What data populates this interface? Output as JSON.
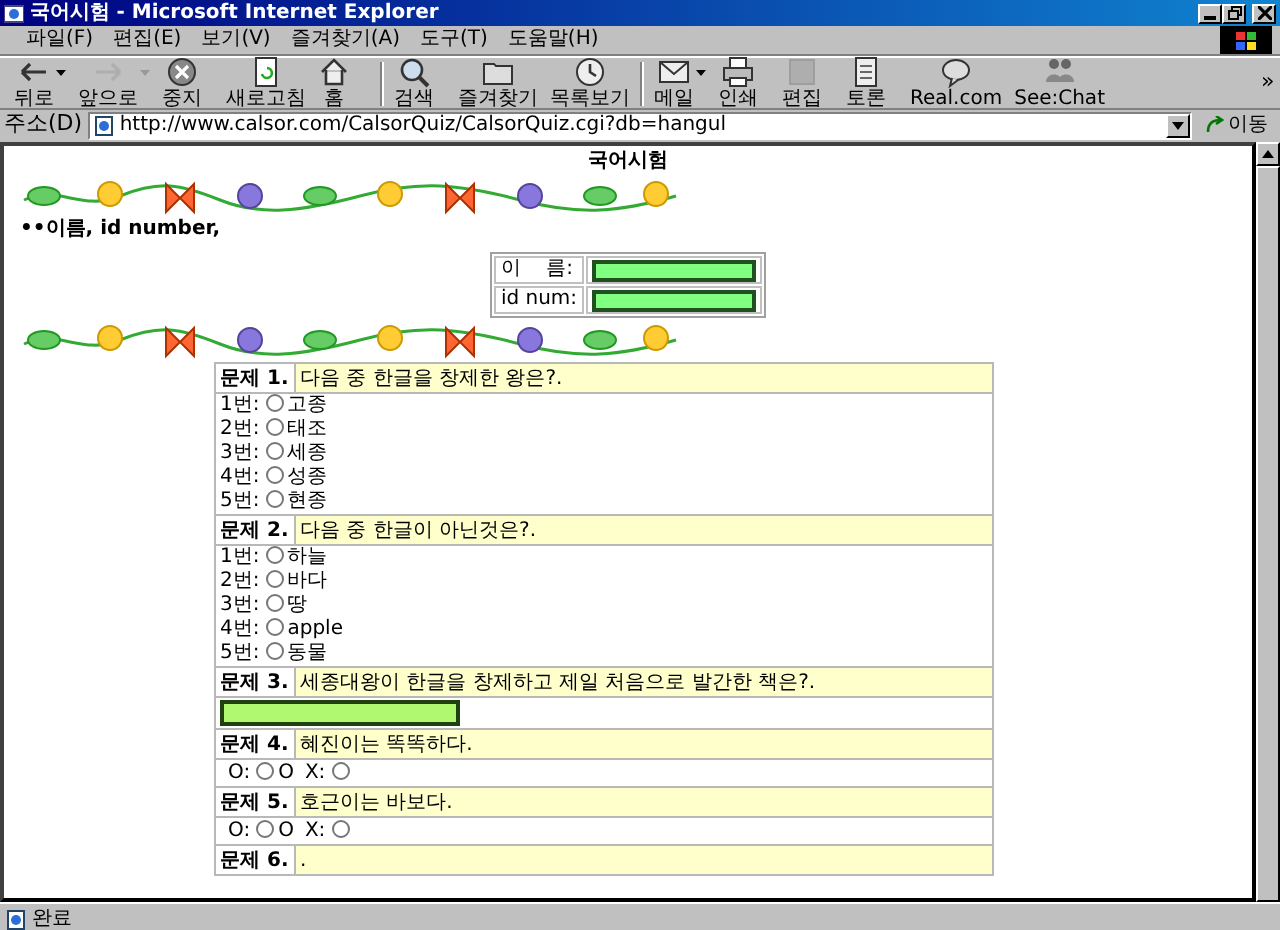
{
  "window": {
    "title": "국어시험 - Microsoft Internet Explorer"
  },
  "menu": [
    "파일(F)",
    "편집(E)",
    "보기(V)",
    "즐겨찾기(A)",
    "도구(T)",
    "도움말(H)"
  ],
  "toolbar": [
    {
      "label": "뒤로",
      "kind": "back",
      "disabled": false,
      "dropdown": true
    },
    {
      "label": "앞으로",
      "kind": "forward",
      "disabled": true,
      "dropdown": true
    },
    {
      "label": "중지",
      "kind": "stop",
      "disabled": false,
      "dropdown": false
    },
    {
      "label": "새로고침",
      "kind": "refresh",
      "disabled": false,
      "dropdown": false
    },
    {
      "label": "홈",
      "kind": "home",
      "disabled": false,
      "dropdown": false
    },
    {
      "label": "검색",
      "kind": "search",
      "disabled": false,
      "dropdown": false
    },
    {
      "label": "즐겨찾기",
      "kind": "favorites",
      "disabled": false,
      "dropdown": false
    },
    {
      "label": "목록보기",
      "kind": "history",
      "disabled": false,
      "dropdown": false
    },
    {
      "label": "메일",
      "kind": "mail",
      "disabled": false,
      "dropdown": true
    },
    {
      "label": "인쇄",
      "kind": "print",
      "disabled": false,
      "dropdown": false
    },
    {
      "label": "편집",
      "kind": "edit",
      "disabled": true,
      "dropdown": false
    },
    {
      "label": "토론",
      "kind": "discuss",
      "disabled": false,
      "dropdown": false
    },
    {
      "label": "Real.com",
      "kind": "real",
      "disabled": false,
      "dropdown": false
    },
    {
      "label": "See:Chat",
      "kind": "chat",
      "disabled": false,
      "dropdown": false
    }
  ],
  "toolbar_more": "»",
  "address": {
    "label": "주소(D)",
    "url": "http://www.calsor.com/CalsorQuiz/CalsorQuiz.cgi?db=hangul",
    "go": "이동"
  },
  "page": {
    "heading": "국어시험",
    "intro": "••이름, id number,",
    "fields": [
      {
        "label": "이    름:"
      },
      {
        "label": "id num:"
      }
    ],
    "questions": [
      {
        "number": "문제 1.",
        "text": "다음 중 한글을 창제한 왕은?.",
        "kind": "choice",
        "options": [
          {
            "label": "1번:",
            "text": "고종",
            "selected": false
          },
          {
            "label": "2번:",
            "text": "태조",
            "selected": false
          },
          {
            "label": "3번:",
            "text": "세종",
            "selected": false
          },
          {
            "label": "4번:",
            "text": "성종",
            "selected": false
          },
          {
            "label": "5번:",
            "text": "현종",
            "selected": false
          }
        ]
      },
      {
        "number": "문제 2.",
        "text": "다음 중 한글이 아닌것은?.",
        "kind": "choice",
        "options": [
          {
            "label": "1번:",
            "text": "하늘",
            "selected": false
          },
          {
            "label": "2번:",
            "text": "바다",
            "selected": false
          },
          {
            "label": "3번:",
            "text": "땅",
            "selected": false
          },
          {
            "label": "4번:",
            "text": "apple",
            "selected": false
          },
          {
            "label": "5번:",
            "text": "동물",
            "selected": false
          }
        ]
      },
      {
        "number": "문제 3.",
        "text": "세종대왕이 한글을 창제하고 제일 처음으로 발간한 책은?.",
        "kind": "text"
      },
      {
        "number": "문제 4.",
        "text": "혜진이는 똑똑하다.",
        "kind": "ox",
        "options": [
          {
            "label": "O:",
            "text": "O",
            "selected": false
          },
          {
            "label": "X:",
            "selected": false
          }
        ]
      },
      {
        "number": "문제 5.",
        "text": "호근이는 바보다.",
        "kind": "ox",
        "options": [
          {
            "label": "O:",
            "text": "O",
            "selected": false
          },
          {
            "label": "X:",
            "selected": false
          }
        ]
      },
      {
        "number": "문제 6.",
        "text": ".",
        "kind": "choice"
      }
    ]
  },
  "status_bar": {
    "text": "완료"
  }
}
